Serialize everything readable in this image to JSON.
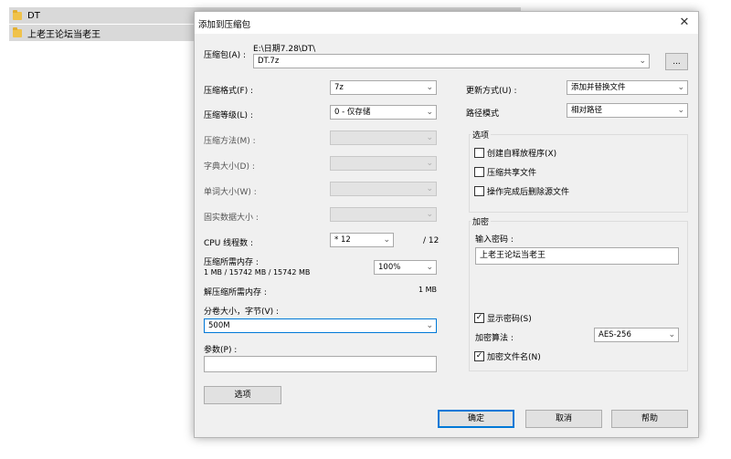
{
  "explorer": {
    "items": [
      {
        "label": "DT"
      },
      {
        "label": "上老王论坛当老王"
      }
    ]
  },
  "dialog": {
    "title": "添加到压缩包",
    "close_symbol": "✕",
    "archive": {
      "label": "压缩包(A) :",
      "path": "E:\\日期7.28\\DT\\",
      "filename": "DT.7z",
      "browse_label": "..."
    },
    "left": {
      "format": {
        "label": "压缩格式(F) :",
        "value": "7z"
      },
      "level": {
        "label": "压缩等级(L) :",
        "value": "0 - 仅存储"
      },
      "method": {
        "label": "压缩方法(M) :",
        "value": ""
      },
      "dict": {
        "label": "字典大小(D) :",
        "value": ""
      },
      "word": {
        "label": "单词大小(W) :",
        "value": ""
      },
      "solid": {
        "label": "固实数据大小 :",
        "value": ""
      },
      "cpu": {
        "label": "CPU 线程数 :",
        "value": "* 12",
        "max": "/ 12"
      },
      "mem_comp": {
        "label": "压缩所需内存 :",
        "detail": "1 MB / 15742 MB / 15742 MB",
        "value": "100%"
      },
      "mem_decomp": {
        "label": "解压缩所需内存 :",
        "value": "1 MB"
      },
      "volume": {
        "label": "分卷大小，字节(V) :",
        "value": "500M"
      },
      "params": {
        "label": "参数(P) :",
        "value": ""
      },
      "options_button": "选项"
    },
    "right": {
      "update": {
        "label": "更新方式(U) :",
        "value": "添加并替换文件"
      },
      "pathmode": {
        "label": "路径模式",
        "value": "相对路径"
      },
      "options_group": {
        "title": "选项",
        "sfx": "创建自释放程序(X)",
        "shared": "压缩共享文件",
        "delete": "操作完成后删除源文件"
      },
      "encryption": {
        "title": "加密",
        "password_label": "输入密码 :",
        "password_value": "上老王论坛当老王",
        "show_password": "显示密码(S)",
        "method_label": "加密算法 :",
        "method_value": "AES-256",
        "encrypt_names": "加密文件名(N)"
      }
    },
    "buttons": {
      "ok": "确定",
      "cancel": "取消",
      "help": "帮助"
    }
  }
}
